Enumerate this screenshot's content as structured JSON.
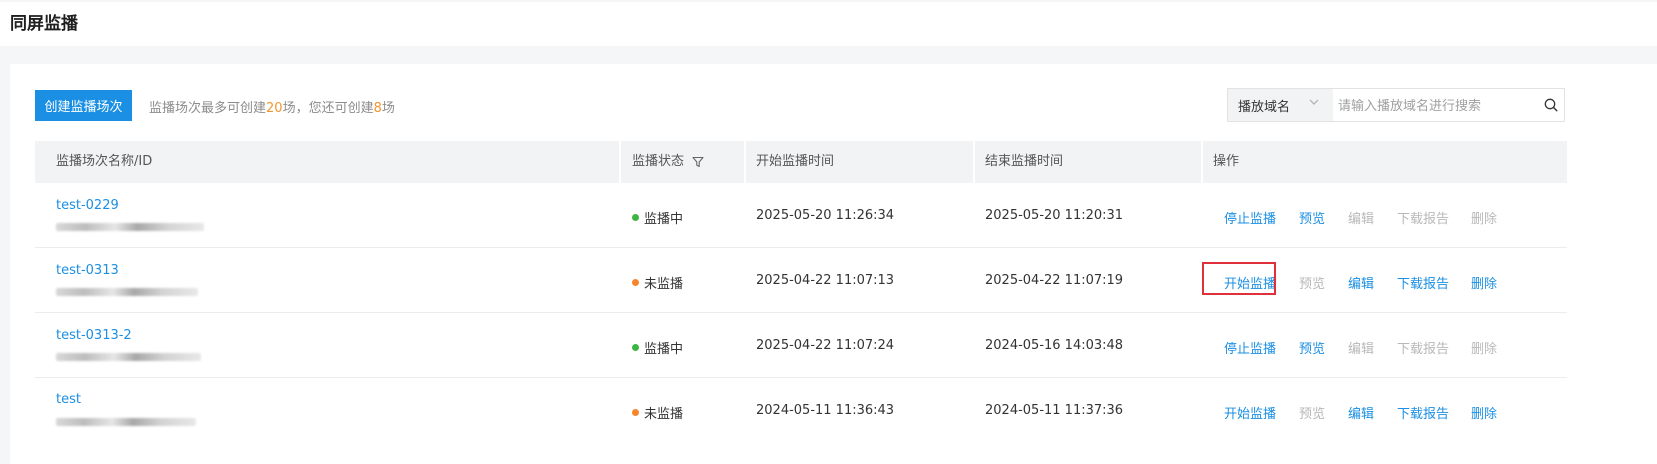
{
  "page": {
    "title": "同屏监播"
  },
  "toolbar": {
    "create_label": "创建监播场次",
    "quota_prefix": "监播场次最多可创建",
    "quota_max": "20",
    "quota_middle": "场，您还可创建",
    "quota_remaining": "8",
    "quota_suffix": "场"
  },
  "search": {
    "select_label": "播放域名",
    "placeholder": "请输入播放域名进行搜索",
    "value": ""
  },
  "table": {
    "headers": {
      "name": "监播场次名称/ID",
      "status": "监播状态",
      "start": "开始监播时间",
      "end": "结束监播时间",
      "actions": "操作"
    },
    "rows": [
      {
        "name": "test-0229",
        "status": "监播中",
        "status_color": "#3cb543",
        "start": "2025-05-20 11:26:34",
        "end": "2025-05-20 11:20:31",
        "actions": [
          {
            "label": "停止监播",
            "enabled": true
          },
          {
            "label": "预览",
            "enabled": true
          },
          {
            "label": "编辑",
            "enabled": false
          },
          {
            "label": "下载报告",
            "enabled": false
          },
          {
            "label": "删除",
            "enabled": false
          }
        ]
      },
      {
        "name": "test-0313",
        "status": "未监播",
        "status_color": "#f5862e",
        "start": "2025-04-22 11:07:13",
        "end": "2025-04-22 11:07:19",
        "actions": [
          {
            "label": "开始监播",
            "enabled": true
          },
          {
            "label": "预览",
            "enabled": false
          },
          {
            "label": "编辑",
            "enabled": true
          },
          {
            "label": "下载报告",
            "enabled": true
          },
          {
            "label": "删除",
            "enabled": true
          }
        ]
      },
      {
        "name": "test-0313-2",
        "status": "监播中",
        "status_color": "#3cb543",
        "start": "2025-04-22 11:07:24",
        "end": "2024-05-16 14:03:48",
        "actions": [
          {
            "label": "停止监播",
            "enabled": true
          },
          {
            "label": "预览",
            "enabled": true
          },
          {
            "label": "编辑",
            "enabled": false
          },
          {
            "label": "下载报告",
            "enabled": false
          },
          {
            "label": "删除",
            "enabled": false
          }
        ]
      },
      {
        "name": "test",
        "status": "未监播",
        "status_color": "#f5862e",
        "start": "2024-05-11 11:36:43",
        "end": "2024-05-11 11:37:36",
        "actions": [
          {
            "label": "开始监播",
            "enabled": true
          },
          {
            "label": "预览",
            "enabled": false
          },
          {
            "label": "编辑",
            "enabled": true
          },
          {
            "label": "下载报告",
            "enabled": true
          },
          {
            "label": "删除",
            "enabled": true
          }
        ]
      }
    ]
  },
  "colors": {
    "accent": "#1a8fe3",
    "highlight": "#e0303a",
    "quota_number": "#f5962e"
  },
  "icons": {
    "chevron": "chevron-down-icon",
    "search": "search-icon",
    "filter": "filter-icon"
  }
}
